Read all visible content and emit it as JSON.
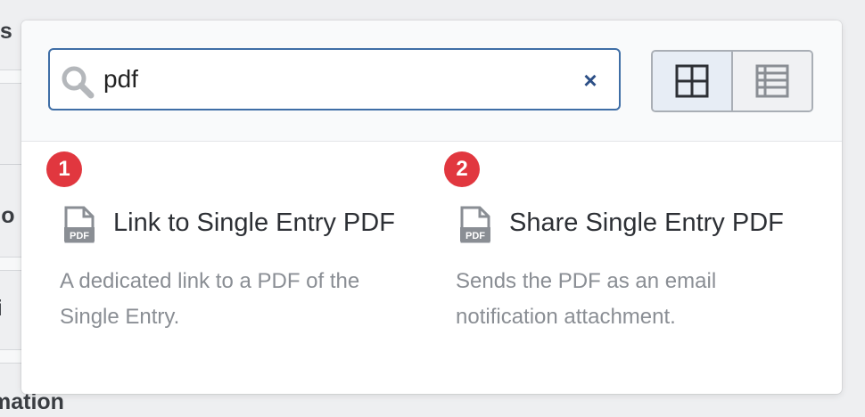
{
  "background": {
    "fragments": [
      "ils",
      "go",
      "ri",
      "mation"
    ]
  },
  "search": {
    "value": "pdf",
    "placeholder": "",
    "clear_label": "×"
  },
  "view_toggle": {
    "grid": {
      "icon": "grid-icon",
      "active": true
    },
    "list": {
      "icon": "list-icon",
      "active": false
    }
  },
  "results": [
    {
      "number": "1",
      "icon": "pdf-file-icon",
      "title": "Link to Single Entry PDF",
      "description_lines": [
        "A dedicated link to a PDF of the",
        "Single Entry."
      ]
    },
    {
      "number": "2",
      "icon": "pdf-file-icon",
      "title": "Share Single Entry PDF",
      "description_lines": [
        "Sends the PDF as an email",
        "notification attachment."
      ]
    }
  ],
  "colors": {
    "accent": "#3f6ea6",
    "badge": "#e1373f",
    "icon_gray": "#8a8e94"
  }
}
